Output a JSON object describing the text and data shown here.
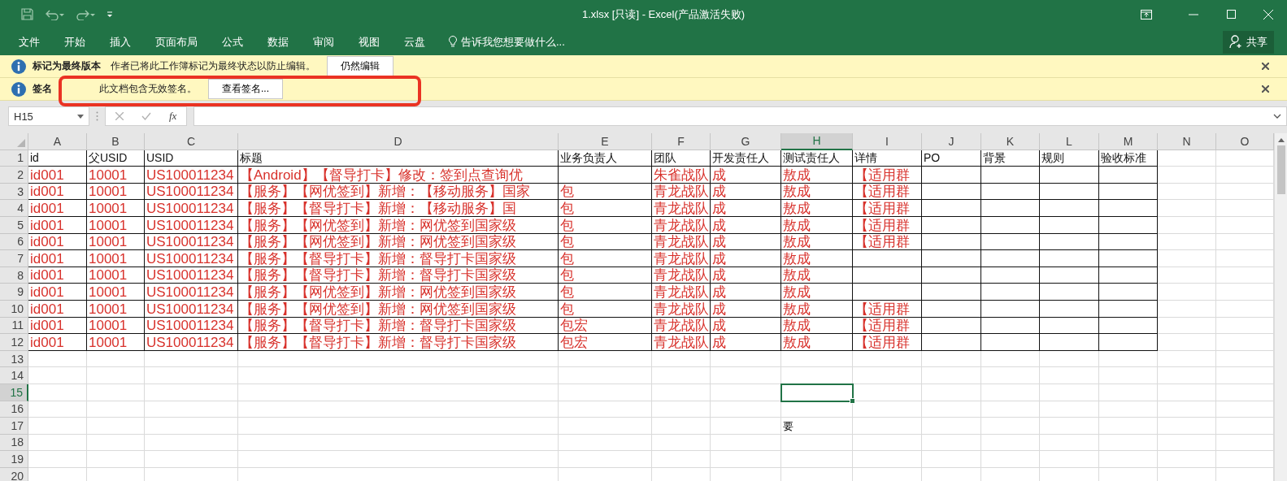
{
  "window": {
    "title": "1.xlsx  [只读] - Excel(产品激活失败)"
  },
  "ribbon": {
    "tabs": [
      {
        "label": "文件",
        "selected": false
      },
      {
        "label": "开始",
        "selected": false
      },
      {
        "label": "插入",
        "selected": false
      },
      {
        "label": "页面布局",
        "selected": false
      },
      {
        "label": "公式",
        "selected": false
      },
      {
        "label": "数据",
        "selected": false
      },
      {
        "label": "审阅",
        "selected": false
      },
      {
        "label": "视图",
        "selected": false
      },
      {
        "label": "云盘",
        "selected": false
      }
    ],
    "tell_me": "告诉我您想要做什么...",
    "share": "共享"
  },
  "message_bars": [
    {
      "title": "标记为最终版本",
      "message": "作者已将此工作簿标记为最终状态以防止编辑。",
      "button": "仍然编辑",
      "highlighted": false
    },
    {
      "title": "签名",
      "message": "此文档包含无效签名。",
      "button": "查看签名...",
      "highlighted": true
    }
  ],
  "formula_bar": {
    "name_box": "H15",
    "function_label": "fx"
  },
  "sheet": {
    "columns": [
      {
        "label": "A",
        "selected": false
      },
      {
        "label": "B",
        "selected": false
      },
      {
        "label": "C",
        "selected": false
      },
      {
        "label": "D",
        "selected": false
      },
      {
        "label": "E",
        "selected": false
      },
      {
        "label": "F",
        "selected": false
      },
      {
        "label": "G",
        "selected": false
      },
      {
        "label": "H",
        "selected": true
      },
      {
        "label": "I",
        "selected": false
      },
      {
        "label": "J",
        "selected": false
      },
      {
        "label": "K",
        "selected": false
      },
      {
        "label": "L",
        "selected": false
      },
      {
        "label": "M",
        "selected": false
      },
      {
        "label": "N",
        "selected": false
      },
      {
        "label": "O",
        "selected": false
      }
    ],
    "rows": [
      {
        "label": "1",
        "selected": false,
        "kind": "heading",
        "cells": {
          "A": "id",
          "B": "父USID",
          "C": "USID",
          "D": "标题",
          "E": "业务负责人",
          "F": "团队",
          "G": "开发责任人",
          "H": "测试责任人",
          "I": "详情",
          "J": "PO",
          "K": "背景",
          "L": "规则",
          "M": "验收标准"
        }
      },
      {
        "label": "2",
        "selected": false,
        "kind": "record",
        "cells": {
          "A": "id001",
          "B": "10001",
          "C": "US100011234",
          "D": "【Android】【督导打卡】修改：签到点查询优",
          "F": "朱雀战队",
          "G": "成",
          "H": "敖成",
          "I": "【适用群"
        }
      },
      {
        "label": "3",
        "selected": false,
        "kind": "record",
        "cells": {
          "A": "id001",
          "B": "10001",
          "C": "US100011234",
          "D": "【服务】【网优签到】新增：【移动服务】国家",
          "E": "包",
          "F": "青龙战队",
          "G": "成",
          "H": "敖成",
          "I": "【适用群"
        }
      },
      {
        "label": "4",
        "selected": false,
        "kind": "record",
        "cells": {
          "A": "id001",
          "B": "10001",
          "C": "US100011234",
          "D": "【服务】【督导打卡】新增：【移动服务】国",
          "E": "包",
          "F": "青龙战队",
          "G": "成",
          "H": "敖成",
          "I": "【适用群"
        }
      },
      {
        "label": "5",
        "selected": false,
        "kind": "record",
        "cells": {
          "A": "id001",
          "B": "10001",
          "C": "US100011234",
          "D": "【服务】【网优签到】新增：网优签到国家级",
          "E": "包",
          "F": "青龙战队",
          "G": "成",
          "H": "敖成",
          "I": "【适用群"
        }
      },
      {
        "label": "6",
        "selected": false,
        "kind": "record",
        "cells": {
          "A": "id001",
          "B": "10001",
          "C": "US100011234",
          "D": "【服务】【网优签到】新增：网优签到国家级",
          "E": "包",
          "F": "青龙战队",
          "G": "成",
          "H": "敖成",
          "I": "【适用群"
        }
      },
      {
        "label": "7",
        "selected": false,
        "kind": "record",
        "cells": {
          "A": "id001",
          "B": "10001",
          "C": "US100011234",
          "D": "【服务】【督导打卡】新增：督导打卡国家级",
          "E": "包",
          "F": "青龙战队",
          "G": "成",
          "H": "敖成"
        }
      },
      {
        "label": "8",
        "selected": false,
        "kind": "record",
        "cells": {
          "A": "id001",
          "B": "10001",
          "C": "US100011234",
          "D": "【服务】【督导打卡】新增：督导打卡国家级",
          "E": "包",
          "F": "青龙战队",
          "G": "成",
          "H": "敖成"
        }
      },
      {
        "label": "9",
        "selected": false,
        "kind": "record",
        "cells": {
          "A": "id001",
          "B": "10001",
          "C": "US100011234",
          "D": "【服务】【网优签到】新增：网优签到国家级",
          "E": "包",
          "F": "青龙战队",
          "G": "成",
          "H": "敖成"
        }
      },
      {
        "label": "10",
        "selected": false,
        "kind": "record",
        "cells": {
          "A": "id001",
          "B": "10001",
          "C": "US100011234",
          "D": "【服务】【网优签到】新增：网优签到国家级",
          "E": "包",
          "F": "青龙战队",
          "G": "成",
          "H": "敖成",
          "I": "【适用群"
        }
      },
      {
        "label": "11",
        "selected": false,
        "kind": "record",
        "cells": {
          "A": "id001",
          "B": "10001",
          "C": "US100011234",
          "D": "【服务】【督导打卡】新增：督导打卡国家级",
          "E": "包宏",
          "F": "青龙战队",
          "G": "成",
          "H": "敖成",
          "I": "【适用群"
        }
      },
      {
        "label": "12",
        "selected": false,
        "kind": "record",
        "cells": {
          "A": "id001",
          "B": "10001",
          "C": "US100011234",
          "D": "【服务】【督导打卡】新增：督导打卡国家级",
          "E": "包宏",
          "F": "青龙战队",
          "G": "成",
          "H": "敖成",
          "I": "【适用群"
        }
      },
      {
        "label": "13",
        "selected": false,
        "kind": "blank",
        "cells": {}
      },
      {
        "label": "14",
        "selected": false,
        "kind": "blank",
        "cells": {}
      },
      {
        "label": "15",
        "selected": true,
        "kind": "blank",
        "cells": {}
      },
      {
        "label": "16",
        "selected": false,
        "kind": "blank",
        "cells": {}
      },
      {
        "label": "17",
        "selected": false,
        "kind": "blank",
        "cells": {
          "H": "要"
        }
      },
      {
        "label": "18",
        "selected": false,
        "kind": "blank",
        "cells": {}
      },
      {
        "label": "19",
        "selected": false,
        "kind": "blank",
        "cells": {}
      },
      {
        "label": "20",
        "selected": false,
        "kind": "blank",
        "cells": {}
      }
    ]
  }
}
